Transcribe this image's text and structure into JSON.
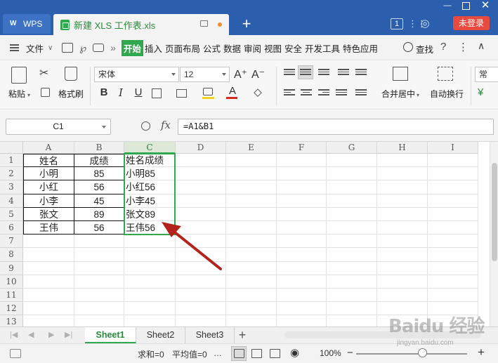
{
  "titlebar": {
    "wps_tab_label": "WPS",
    "doc_tab_label": "新建 XLS 工作表.xls",
    "window_count": "1",
    "login_label": "未登录"
  },
  "menubar": {
    "file_label": "文件",
    "items": [
      "开始",
      "插入",
      "页面布局",
      "公式",
      "数据",
      "审阅",
      "视图",
      "安全",
      "开发工具",
      "特色应用"
    ],
    "search_label": "查找"
  },
  "ribbon": {
    "paste_label": "粘贴",
    "format_painter_label": "格式刷",
    "font_name": "宋体",
    "font_size": "12",
    "merge_center_label": "合并居中",
    "wrap_text_label": "自动换行",
    "number_format_label": "常"
  },
  "formula_bar": {
    "name_box": "C1",
    "fx_label": "fx",
    "formula": "=A1&B1"
  },
  "sheet": {
    "columns": [
      "A",
      "B",
      "C",
      "D",
      "E",
      "F",
      "G",
      "H",
      "I"
    ],
    "rows": [
      "1",
      "2",
      "3",
      "4",
      "5",
      "6",
      "7",
      "8",
      "9",
      "10",
      "11",
      "12",
      "13"
    ],
    "table": [
      [
        "姓名",
        "成绩",
        "姓名成绩"
      ],
      [
        "小明",
        "85",
        "小明85"
      ],
      [
        "小红",
        "56",
        "小红56"
      ],
      [
        "小李",
        "45",
        "小李45"
      ],
      [
        "张文",
        "89",
        "张文89"
      ],
      [
        "王伟",
        "56",
        "王伟56"
      ]
    ],
    "selected_cell": "C1",
    "accent_color": "#2fa84f",
    "arrow_color": "#b3221b"
  },
  "sheet_tabs": {
    "tabs": [
      "Sheet1",
      "Sheet2",
      "Sheet3"
    ],
    "active": "Sheet1"
  },
  "status_bar": {
    "sum_label": "求和=0",
    "avg_label": "平均值=0",
    "ellipsis": "…",
    "zoom": "100%"
  },
  "watermark": {
    "brand": "Baidu 经验",
    "url": "jingyan.baidu.com"
  }
}
